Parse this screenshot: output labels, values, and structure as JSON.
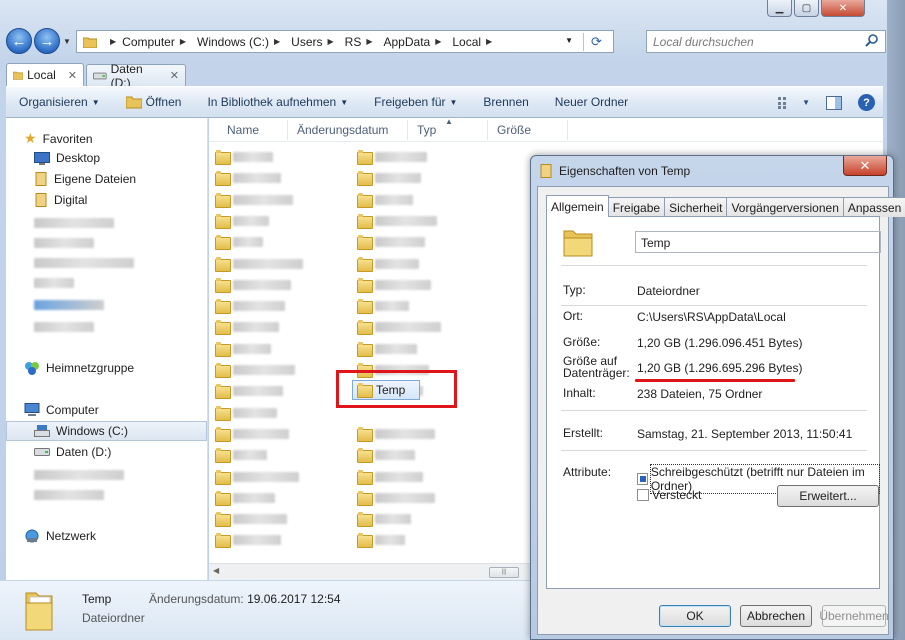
{
  "explorer": {
    "address": [
      "Computer",
      "Windows (C:)",
      "Users",
      "RS",
      "AppData",
      "Local"
    ],
    "search_placeholder": "Local durchsuchen",
    "tabs": [
      {
        "label": "Local"
      },
      {
        "label": "Daten (D:)"
      }
    ],
    "toolbar": {
      "organize": "Organisieren",
      "open": "Öffnen",
      "library": "In Bibliothek aufnehmen",
      "share": "Freigeben für",
      "burn": "Brennen",
      "new_folder": "Neuer Ordner"
    },
    "nav": {
      "favorites": "Favoriten",
      "desktop": "Desktop",
      "my_files": "Eigene Dateien",
      "digital": "Digital",
      "homegroup": "Heimnetzgruppe",
      "computer": "Computer",
      "drive_c": "Windows (C:)",
      "drive_d": "Daten (D:)",
      "network": "Netzwerk"
    },
    "columns": {
      "name": "Name",
      "modified": "Änderungsdatum",
      "type": "Typ",
      "size": "Größe"
    },
    "selected_folder": "Temp",
    "details": {
      "name": "Temp",
      "type": "Dateiordner",
      "modified_label": "Änderungsdatum:",
      "modified_value": "19.06.2017 12:54"
    }
  },
  "dialog": {
    "title": "Eigenschaften von Temp",
    "tabs": [
      "Allgemein",
      "Freigabe",
      "Sicherheit",
      "Vorgängerversionen",
      "Anpassen"
    ],
    "name": "Temp",
    "type_label": "Typ:",
    "type_value": "Dateiordner",
    "location_label": "Ort:",
    "location_value": "C:\\Users\\RS\\AppData\\Local",
    "size_label": "Größe:",
    "size_value": "1,20 GB (1.296.096.451 Bytes)",
    "disk_size_label_1": "Größe auf",
    "disk_size_label_2": "Datenträger:",
    "disk_size_value": "1,20 GB (1.296.695.296 Bytes)",
    "contents_label": "Inhalt:",
    "contents_value": "238 Dateien, 75 Ordner",
    "created_label": "Erstellt:",
    "created_value": "Samstag, 21. September 2013, 11:50:41",
    "attributes_label": "Attribute:",
    "readonly_label": "Schreibgeschützt (betrifft nur Dateien im Ordner)",
    "hidden_label": "Versteckt",
    "advanced_button": "Erweitert...",
    "ok": "OK",
    "cancel": "Abbrechen",
    "apply": "Übernehmen"
  },
  "colors": {
    "highlight": "#e0151b",
    "accent": "#2a62b3"
  }
}
